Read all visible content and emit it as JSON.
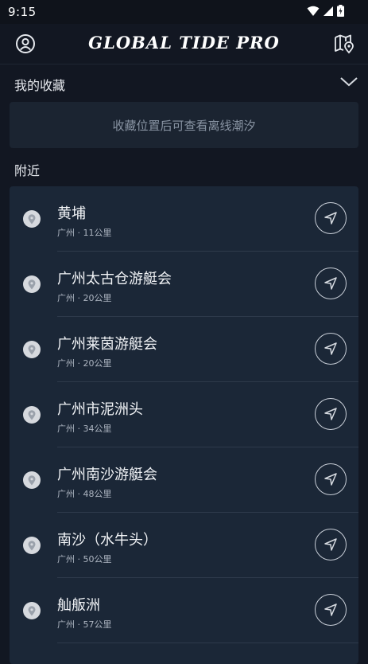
{
  "status_bar": {
    "time": "9:15"
  },
  "header": {
    "title": "GLOBAL TIDE PRO"
  },
  "favorites": {
    "title": "我的收藏",
    "empty_message": "收藏位置后可查看离线潮汐"
  },
  "nearby": {
    "title": "附近",
    "items": [
      {
        "name": "黄埔",
        "city": "广州",
        "distance": "11公里"
      },
      {
        "name": "广州太古仓游艇会",
        "city": "广州",
        "distance": "20公里"
      },
      {
        "name": "广州莱茵游艇会",
        "city": "广州",
        "distance": "20公里"
      },
      {
        "name": "广州市泥洲头",
        "city": "广州",
        "distance": "34公里"
      },
      {
        "name": "广州南沙游艇会",
        "city": "广州",
        "distance": "48公里"
      },
      {
        "name": "南沙（水牛头）",
        "city": "广州",
        "distance": "50公里"
      },
      {
        "name": "舢舨洲",
        "city": "广州",
        "distance": "57公里"
      }
    ]
  },
  "icons": {
    "account": "account-circle-icon",
    "map": "map-location-icon",
    "collapse": "chevron-down-icon",
    "pin": "location-pin-icon",
    "navigate": "navigation-arrow-icon"
  }
}
